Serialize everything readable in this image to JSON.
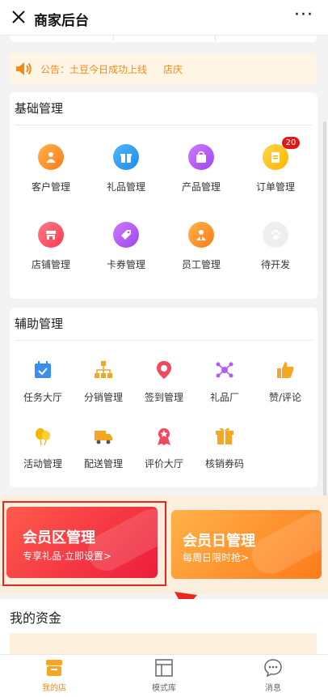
{
  "header": {
    "title": "商家后台",
    "more": "···"
  },
  "notice": {
    "text": "公告：土豆今日成功上线",
    "extra": "店庆"
  },
  "basic": {
    "title": "基础管理",
    "items": [
      {
        "label": "客户管理",
        "icon": "person-icon",
        "color": "#ff8a1d"
      },
      {
        "label": "礼品管理",
        "icon": "gift-icon",
        "color": "#2f9df2"
      },
      {
        "label": "产品管理",
        "icon": "bag-icon",
        "color": "#b05cf0"
      },
      {
        "label": "订单管理",
        "icon": "clipboard-icon",
        "color": "#ffc22a",
        "badge": "20"
      },
      {
        "label": "店铺管理",
        "icon": "store-icon",
        "color": "#ff4a5e"
      },
      {
        "label": "卡券管理",
        "icon": "ticket-icon",
        "color": "#b05cf0"
      },
      {
        "label": "员工管理",
        "icon": "staff-icon",
        "color": "#ff8a1d"
      },
      {
        "label": "待开发",
        "icon": "paw-icon",
        "color": "#eaeaea"
      }
    ]
  },
  "aux": {
    "title": "辅助管理",
    "items": [
      {
        "label": "任务大厅",
        "icon": "calendar-check-icon"
      },
      {
        "label": "分销管理",
        "icon": "hierarchy-icon"
      },
      {
        "label": "签到管理",
        "icon": "location-pin-icon"
      },
      {
        "label": "礼品厂",
        "icon": "network-icon"
      },
      {
        "label": "赞/评论",
        "icon": "thumbs-up-icon"
      },
      {
        "label": "活动管理",
        "icon": "balloon-icon"
      },
      {
        "label": "配送管理",
        "icon": "truck-icon"
      },
      {
        "label": "评价大厅",
        "icon": "medal-icon"
      },
      {
        "label": "核销券码",
        "icon": "gift-box-icon"
      }
    ]
  },
  "banners": [
    {
      "title": "会员区管理",
      "subtitle": "专享礼品·立即设置>"
    },
    {
      "title": "会员日管理",
      "subtitle": "每周日限时抢>"
    }
  ],
  "fund": {
    "title": "我的资金"
  },
  "tabs": [
    {
      "label": "我的店",
      "icon": "store-tab-icon",
      "active": true
    },
    {
      "label": "模式库",
      "icon": "layout-icon",
      "active": false
    },
    {
      "label": "消息",
      "icon": "chat-icon",
      "active": false
    }
  ],
  "colors": {
    "accent": "#f08a1c",
    "highlight": "#e8251f"
  }
}
